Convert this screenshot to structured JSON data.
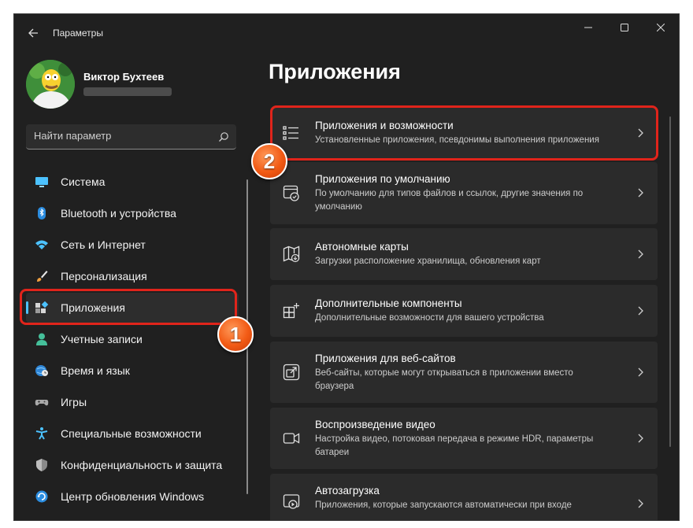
{
  "window": {
    "title": "Параметры"
  },
  "user": {
    "name": "Виктор Бухтеев"
  },
  "search": {
    "placeholder": "Найти параметр"
  },
  "nav": {
    "items": [
      {
        "label": "Система",
        "icon": "monitor-icon"
      },
      {
        "label": "Bluetooth и устройства",
        "icon": "bluetooth-icon"
      },
      {
        "label": "Сеть и Интернет",
        "icon": "wifi-icon"
      },
      {
        "label": "Персонализация",
        "icon": "brush-icon"
      },
      {
        "label": "Приложения",
        "icon": "apps-icon",
        "active": true
      },
      {
        "label": "Учетные записи",
        "icon": "person-icon"
      },
      {
        "label": "Время и язык",
        "icon": "globe-clock-icon"
      },
      {
        "label": "Игры",
        "icon": "gamepad-icon"
      },
      {
        "label": "Специальные возможности",
        "icon": "accessibility-icon"
      },
      {
        "label": "Конфиденциальность и защита",
        "icon": "shield-icon"
      },
      {
        "label": "Центр обновления Windows",
        "icon": "update-icon"
      }
    ]
  },
  "main": {
    "title": "Приложения",
    "cards": [
      {
        "title": "Приложения и возможности",
        "desc": "Установленные приложения, псевдонимы выполнения приложения",
        "icon": "list-icon"
      },
      {
        "title": "Приложения по умолчанию",
        "desc": "По умолчанию для типов файлов и ссылок, другие значения по умолчанию",
        "icon": "default-apps-icon"
      },
      {
        "title": "Автономные карты",
        "desc": "Загрузки расположение хранилища, обновления карт",
        "icon": "map-icon"
      },
      {
        "title": "Дополнительные компоненты",
        "desc": "Дополнительные возможности для вашего устройства",
        "icon": "add-components-icon"
      },
      {
        "title": "Приложения для веб-сайтов",
        "desc": "Веб-сайты, которые могут открываться в приложении вместо браузера",
        "icon": "web-apps-icon"
      },
      {
        "title": "Воспроизведение видео",
        "desc": "Настройка видео, потоковая передача в режиме HDR, параметры батареи",
        "icon": "video-icon"
      },
      {
        "title": "Автозагрузка",
        "desc": "Приложения, которые запускаются автоматически при входе",
        "icon": "startup-icon"
      }
    ]
  },
  "annotations": {
    "badge1": "1",
    "badge2": "2"
  },
  "colors": {
    "accent": "#4cc2ff",
    "highlight": "#e0241b",
    "badge": "#f25a14"
  }
}
